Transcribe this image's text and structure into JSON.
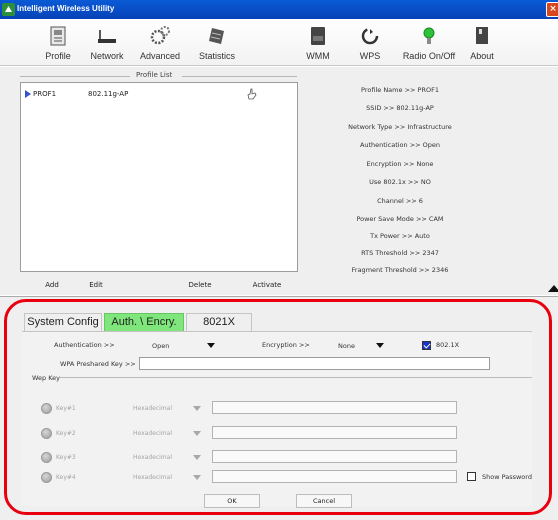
{
  "window": {
    "title": "Intelligent Wireless Utility",
    "close_glyph": "×"
  },
  "toolbar": {
    "items": [
      {
        "label": "Profile",
        "icon": "profile-icon"
      },
      {
        "label": "Network",
        "icon": "network-icon"
      },
      {
        "label": "Advanced",
        "icon": "advanced-icon"
      },
      {
        "label": "Statistics",
        "icon": "statistics-icon"
      },
      {
        "label": "WMM",
        "icon": "wmm-icon"
      },
      {
        "label": "WPS",
        "icon": "wps-icon"
      },
      {
        "label": "Radio On/Off",
        "icon": "radio-icon"
      },
      {
        "label": "About",
        "icon": "about-icon"
      }
    ]
  },
  "profile_list": {
    "header": "Profile List",
    "rows": [
      {
        "name": "PROF1",
        "ssid": "802.11g-AP"
      }
    ],
    "buttons": {
      "add": "Add",
      "edit": "Edit",
      "delete": "Delete",
      "activate": "Activate"
    }
  },
  "details": [
    "Profile Name >> PROF1",
    "SSID >> 802.11g-AP",
    "Network Type >> Infrastructure",
    "Authentication >> Open",
    "Encryption >> None",
    "Use 802.1x >> NO",
    "Channel >> 6",
    "Power Save Mode >> CAM",
    "Tx Power >> Auto",
    "RTS Threshold >> 2347",
    "Fragment Threshold >> 2346"
  ],
  "tabs": [
    {
      "label": "System Config",
      "active": false
    },
    {
      "label": "Auth. \\ Encry.",
      "active": true
    },
    {
      "label": "8021X",
      "active": false
    }
  ],
  "auth": {
    "authentication_label": "Authentication >>",
    "authentication_value": "Open",
    "encryption_label": "Encryption >>",
    "encryption_value": "None",
    "dot1x_label": "802.1X",
    "dot1x_checked": true,
    "wpa_label": "WPA Preshared Key >>",
    "wpa_value": ""
  },
  "wep": {
    "header": "Wep Key",
    "keys": [
      {
        "label": "Key#1",
        "format": "Hexadecimal",
        "value": ""
      },
      {
        "label": "Key#2",
        "format": "Hexadecimal",
        "value": ""
      },
      {
        "label": "Key#3",
        "format": "Hexadecimal",
        "value": ""
      },
      {
        "label": "Key#4",
        "format": "Hexadecimal",
        "value": ""
      }
    ],
    "show_password_label": "Show Password"
  },
  "actions": {
    "ok": "OK",
    "cancel": "Cancel"
  },
  "colors": {
    "active_tab": "#7ee67a",
    "highlight_frame": "#e8000f",
    "titlebar": "#0a5ad6"
  }
}
